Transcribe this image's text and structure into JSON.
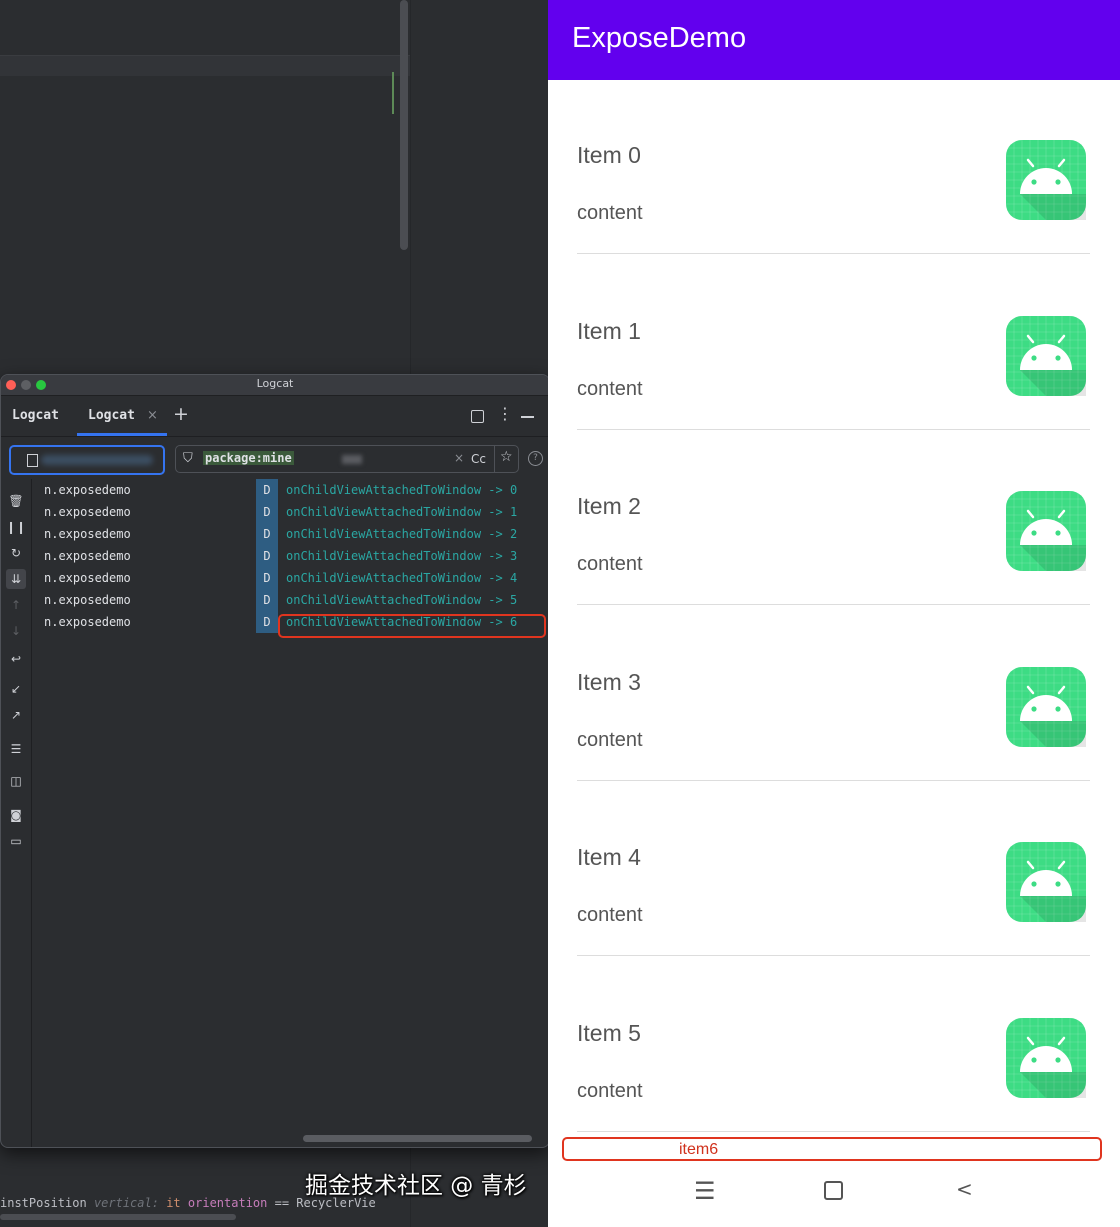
{
  "ide": {
    "code_parts": [
      "instPosition",
      "vertical:",
      "it",
      "orientation",
      "== RecyclerVie"
    ]
  },
  "logcat": {
    "window_title": "Logcat",
    "tabs": [
      {
        "label": "Logcat"
      },
      {
        "label": "Logcat",
        "active": true
      }
    ],
    "tab_close": "×",
    "tab_add": "+",
    "filter_text": "package:mine",
    "filter_clear": "×",
    "filter_case": "Cc",
    "filter_star": "☆",
    "help": "?",
    "toolbar_icons": [
      "trash-icon",
      "pause-icon",
      "restart-icon",
      "scroll-to-end-icon",
      "up-arrow-icon",
      "down-arrow-icon",
      "soft-wrap-icon",
      "collapse-icon",
      "expand-icon",
      "settings-icon",
      "split-icon",
      "screenshot-icon",
      "screen-record-icon"
    ],
    "rows": [
      {
        "package": "n.exposedemo",
        "level": "D",
        "message": "onChildViewAttachedToWindow -> 0"
      },
      {
        "package": "n.exposedemo",
        "level": "D",
        "message": "onChildViewAttachedToWindow -> 1"
      },
      {
        "package": "n.exposedemo",
        "level": "D",
        "message": "onChildViewAttachedToWindow -> 2"
      },
      {
        "package": "n.exposedemo",
        "level": "D",
        "message": "onChildViewAttachedToWindow -> 3"
      },
      {
        "package": "n.exposedemo",
        "level": "D",
        "message": "onChildViewAttachedToWindow -> 4"
      },
      {
        "package": "n.exposedemo",
        "level": "D",
        "message": "onChildViewAttachedToWindow -> 5"
      },
      {
        "package": "n.exposedemo",
        "level": "D",
        "message": "onChildViewAttachedToWindow -> 6"
      }
    ]
  },
  "phone": {
    "app_title": "ExposeDemo",
    "app_bar_color": "#6200ee",
    "items": [
      {
        "title": "Item 0",
        "content": "content"
      },
      {
        "title": "Item 1",
        "content": "content"
      },
      {
        "title": "Item 2",
        "content": "content"
      },
      {
        "title": "Item 3",
        "content": "content"
      },
      {
        "title": "Item 4",
        "content": "content"
      },
      {
        "title": "Item 5",
        "content": "content"
      }
    ],
    "partial_item_label": "item6",
    "nav": {
      "menu": "☰",
      "back": "<"
    }
  },
  "watermark": "掘金技术社区 @ 青杉",
  "colors": {
    "highlight": "#e0351f",
    "log_text": "#2aa7a3",
    "level_badge": "#2e5d82",
    "android_icon": "#3ddc84"
  }
}
